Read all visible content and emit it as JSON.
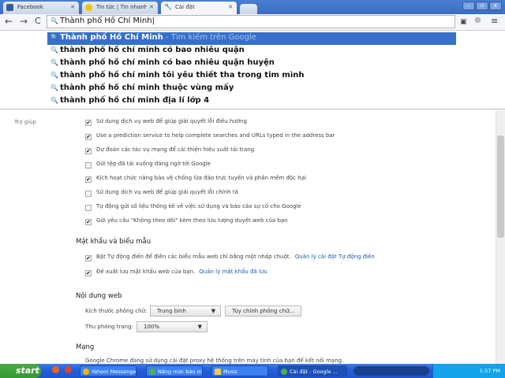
{
  "tabs": [
    {
      "label": "Facebook",
      "icon": "facebook-icon"
    },
    {
      "label": "Tin tức | Tin nhanh công ngh",
      "icon": "news-icon"
    },
    {
      "label": "Cài đặt",
      "icon": "wrench-icon",
      "active": true
    }
  ],
  "omnibox": {
    "value": "Thành phố Hồ Chí Minh"
  },
  "suggestions": [
    {
      "text": "Thành phố Hồ Chí Minh",
      "hint": " - Tìm kiếm trên Google"
    },
    {
      "text": "thành phố hồ chí minh có bao nhiêu quận"
    },
    {
      "text": "thành phố hồ chí minh có bao nhiêu quận huyện"
    },
    {
      "text": "thành phố hồ chí minh tôi yêu thiết tha trong tim mình"
    },
    {
      "text": "thành phố hồ chí minh thuộc vùng mấy"
    },
    {
      "text": "thành phố hồ chí minh địa lí lớp 4"
    }
  ],
  "sidebar": {
    "help": "Trợ giúp"
  },
  "privacy": [
    {
      "label": "Sử dụng dịch vụ web để giúp giải quyết lỗi điều hướng",
      "checked": true
    },
    {
      "label": "Use a prediction service to help complete searches and URLs typed in the address bar",
      "checked": true
    },
    {
      "label": "Dự đoán các tác vụ mạng để cải thiện hiệu suất tải trang",
      "checked": true
    },
    {
      "label": "Gửi tệp đã tải xuống đáng ngờ tới Google",
      "checked": false
    },
    {
      "label": "Kích hoạt chức năng bảo vệ chống lừa đảo trực tuyến và phần mềm độc hại",
      "checked": true
    },
    {
      "label": "Sử dụng dịch vụ web để giúp giải quyết lỗi chính tả",
      "checked": false
    },
    {
      "label": "Tự động gửi số liệu thống kê về việc sử dụng và báo cáo sự cố cho Google",
      "checked": false
    },
    {
      "label": "Gửi yêu cầu \"Không theo dõi\" kèm theo lưu lượng duyệt web của bạn",
      "checked": true
    }
  ],
  "passwords": {
    "title": "Mật khẩu và biểu mẫu",
    "items": [
      {
        "label": "Bật Tự động điền để điền các biểu mẫu web chỉ bằng một nhấp chuột.",
        "link": "Quản lý cài đặt Tự động điền",
        "checked": true
      },
      {
        "label": "Đề xuất lưu mật khẩu web của bạn.",
        "link": "Quản lý mật khẩu đã lưu",
        "checked": true
      }
    ]
  },
  "webcontent": {
    "title": "Nội dung web",
    "font_size_label": "Kích thước phông chữ:",
    "font_size_value": "Trung bình",
    "customize_fonts": "Tùy chỉnh phông chữ...",
    "zoom_label": "Thu phóng trang:",
    "zoom_value": "100%"
  },
  "network": {
    "title": "Mạng",
    "text": "Google Chrome đang sử dụng cài đặt proxy hệ thống trên máy tính của bạn để kết nối mạng."
  },
  "taskbar": {
    "start": "start",
    "tasks": [
      "Yahoo! Messenger",
      "Nâng mức bảo m...",
      "Music",
      "Cài đặt - Google ..."
    ],
    "clock": "1:57 PM"
  }
}
